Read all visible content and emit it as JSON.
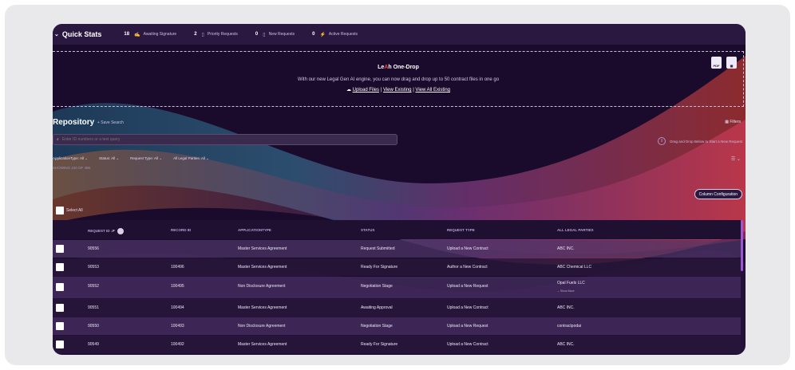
{
  "quick_stats": {
    "title": "Quick Stats",
    "items": [
      {
        "count": "18",
        "icon": "signature-icon",
        "label": "Awaiting Signature"
      },
      {
        "count": "2",
        "icon": "document-icon",
        "label": "Priority Requests"
      },
      {
        "count": "0",
        "icon": "document-icon",
        "label": "New Requests"
      },
      {
        "count": "0",
        "icon": "pulse-icon",
        "label": "Active Requests"
      }
    ]
  },
  "drop": {
    "title_pre": "Le",
    "title_ai": "A",
    "title_post": "h One-Drop",
    "description": "With our new Legal Gen AI engine, you can now drag and drop up to 50 contract files in one go",
    "upload": "Upload Files",
    "sep": "|",
    "view_existing": "View Existing",
    "view_all": "View All Existing",
    "pdf_label": "PDF"
  },
  "repository": {
    "title": "Repository",
    "save_search": "+ Save Search",
    "filters": "Filters",
    "search_placeholder": "Enter ID numbers or a text query",
    "dnd_note": "Drag and Drop Below to Start a New Request",
    "filter_items": [
      "ApplicationType: All",
      "Status: All",
      "Request Type: All",
      "All Legal Parties: All"
    ],
    "showing": "SHOWING 100 OF 496",
    "column_config": "Column Configuration",
    "select_all": "Select All"
  },
  "table": {
    "headers": [
      "REQUEST ID",
      "RECORD ID",
      "APPLICATIONTYPE",
      "STATUS",
      "REQUEST TYPE",
      "ALL LEGAL PARTIES"
    ],
    "sort_icon": "↓F",
    "rows": [
      {
        "request_id": "90556",
        "record_id": "",
        "app_type": "Master Services Agreement",
        "status": "Request Submitted",
        "request_type": "Upload a New Contract",
        "party": "ABC INC.",
        "sub": ""
      },
      {
        "request_id": "90553",
        "record_id": "100496",
        "app_type": "Master Services Agreement",
        "status": "Ready For Signature",
        "request_type": "Author a New Contract",
        "party": "ABC Chemical LLC",
        "sub": ""
      },
      {
        "request_id": "90552",
        "record_id": "100495",
        "app_type": "Non Disclosure Agreement",
        "status": "Negotiation Stage",
        "request_type": "Upload a New Request",
        "party": "Opal Fuels LLC",
        "sub": "⌄ Show More"
      },
      {
        "request_id": "90551",
        "record_id": "100494",
        "app_type": "Master Services Agreement",
        "status": "Awaiting Approval",
        "request_type": "Upload a New Contract",
        "party": "ABC INC.",
        "sub": ""
      },
      {
        "request_id": "90550",
        "record_id": "100493",
        "app_type": "Non Disclosure Agreement",
        "status": "Negotiation Stage",
        "request_type": "Upload a New Request",
        "party": "contractpodai",
        "sub": ""
      },
      {
        "request_id": "90549",
        "record_id": "100492",
        "app_type": "Master Services Agreement",
        "status": "Ready For Signature",
        "request_type": "Upload a New Contract",
        "party": "ABC INC.",
        "sub": ""
      }
    ]
  },
  "colors": {
    "bg": "#1a0b2c",
    "bar": "#2a1840",
    "accent": "#9b55d6",
    "ai_red": "#e8463e"
  }
}
